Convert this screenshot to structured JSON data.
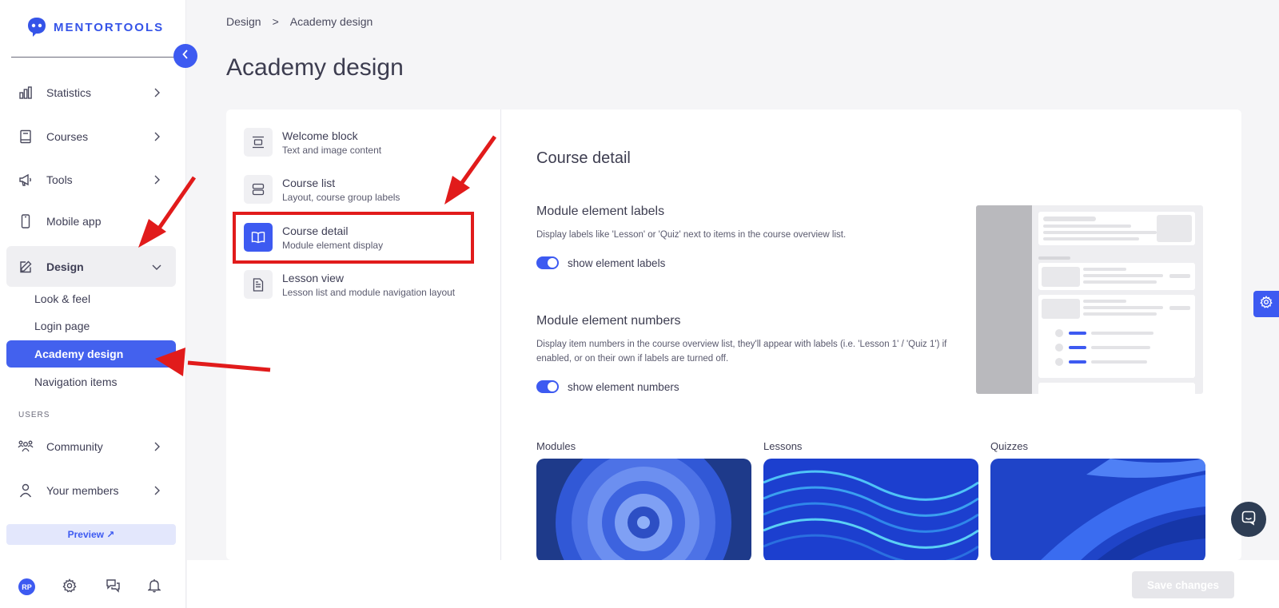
{
  "brand": {
    "name": "MENTORTOOLS",
    "color": "#3554e8"
  },
  "sidebar": {
    "items": [
      {
        "label": "Statistics",
        "icon": "bar-chart-icon"
      },
      {
        "label": "Courses",
        "icon": "book-icon"
      },
      {
        "label": "Tools",
        "icon": "megaphone-icon"
      },
      {
        "label": "Mobile app",
        "icon": "phone-icon"
      },
      {
        "label": "Design",
        "icon": "pencil-icon"
      }
    ],
    "design_subitems": [
      "Look & feel",
      "Login page",
      "Academy design",
      "Navigation items"
    ],
    "users_section_label": "USERS",
    "users_items": [
      {
        "label": "Community",
        "icon": "community-icon"
      },
      {
        "label": "Your members",
        "icon": "user-icon"
      }
    ],
    "preview_label": "Preview ↗",
    "avatar_initials": "RP"
  },
  "breadcrumb": {
    "parent": "Design",
    "separator": ">",
    "current": "Academy design"
  },
  "page_title": "Academy design",
  "settings_menu": [
    {
      "title": "Welcome block",
      "subtitle": "Text and image content",
      "icon": "align-center-icon"
    },
    {
      "title": "Course list",
      "subtitle": "Layout, course group labels",
      "icon": "list-layout-icon"
    },
    {
      "title": "Course detail",
      "subtitle": "Module element display",
      "icon": "open-book-icon"
    },
    {
      "title": "Lesson view",
      "subtitle": "Lesson list and module navigation layout",
      "icon": "document-icon"
    }
  ],
  "detail": {
    "title": "Course detail",
    "labels_title": "Module element labels",
    "labels_desc": "Display labels like 'Lesson' or 'Quiz' next to items in the course overview list.",
    "labels_toggle": "show element labels",
    "numbers_title": "Module element numbers",
    "numbers_desc": "Display item numbers in the course overview list, they'll appear with labels (i.e. 'Lesson 1' / 'Quiz 1') if enabled, or on their own if labels are turned off.",
    "numbers_toggle": "show element numbers",
    "image_labels": [
      "Modules",
      "Lessons",
      "Quizzes"
    ]
  },
  "save_label": "Save changes",
  "colors": {
    "accent": "#3d5af1",
    "annotation": "#e11b1b"
  }
}
